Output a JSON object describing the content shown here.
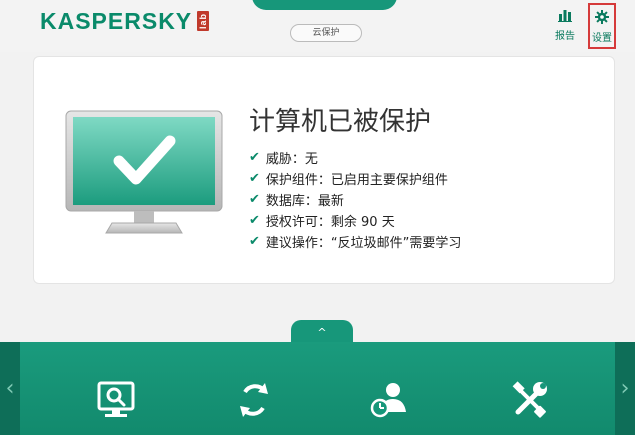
{
  "header": {
    "logo_text": "KASPERSKY",
    "logo_suffix": "lab",
    "cloud_label": "云保护",
    "report_label": "报告",
    "settings_label": "设置"
  },
  "status": {
    "title": "计算机已被保护",
    "items": [
      "威胁：无",
      "保护组件：已启用主要保护组件",
      "数据库：最新",
      "授权许可：剩余 90 天",
      "建议操作：“反垃圾邮件”需要学习"
    ]
  },
  "bottom": {
    "pull_tab": "^",
    "left_arrow": "‹",
    "right_arrow": "›",
    "tools": [
      "scan-icon",
      "update-icon",
      "parental-control-icon",
      "tools-icon"
    ]
  },
  "colors": {
    "accent": "#17977a",
    "brand": "#0a8a6a",
    "highlight": "#d53a3a"
  }
}
